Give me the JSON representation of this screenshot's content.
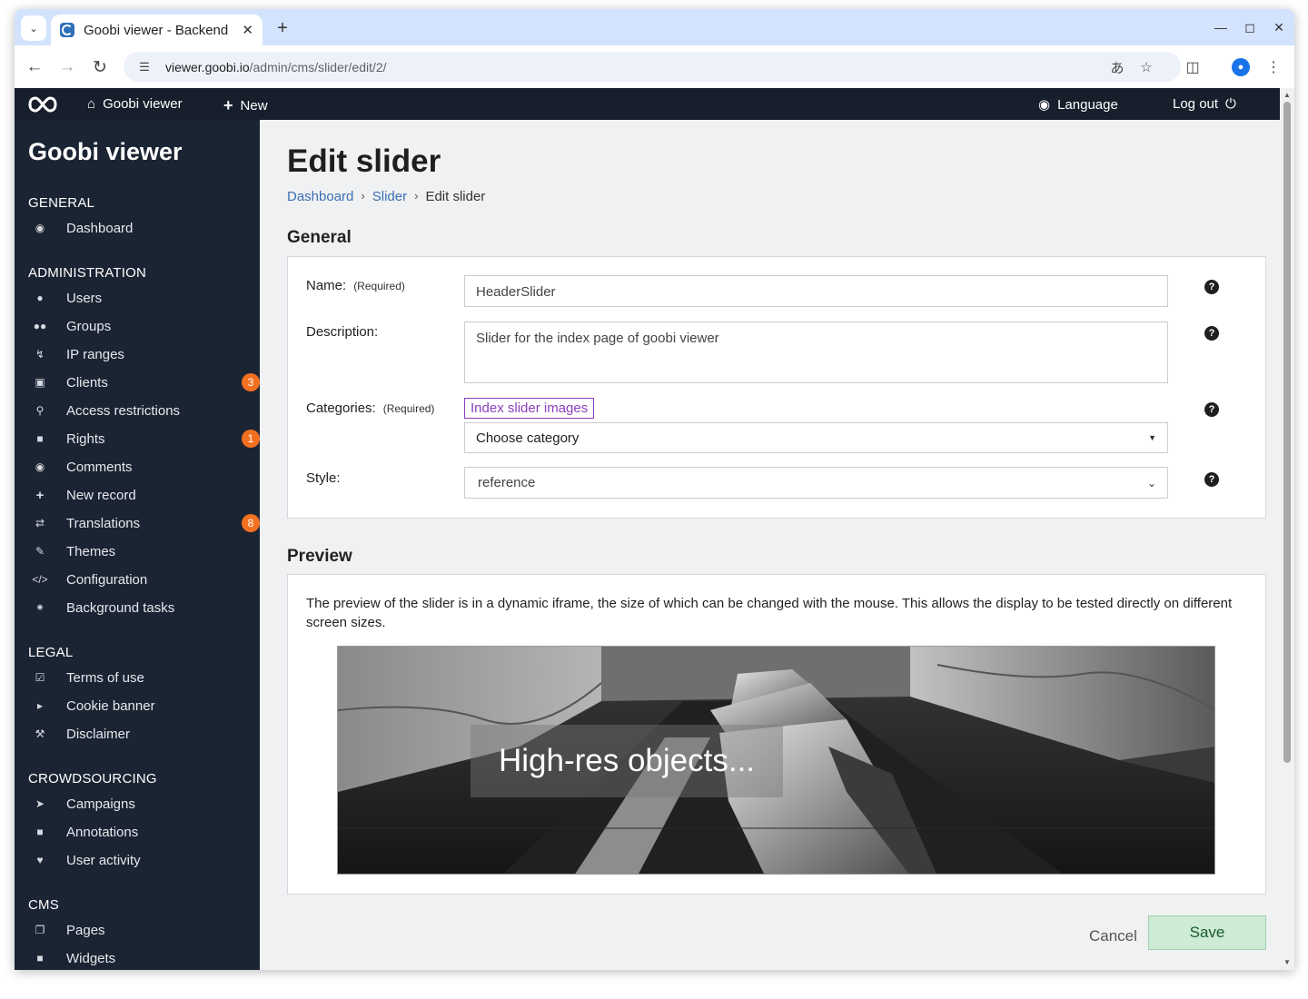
{
  "browser": {
    "tab_title": "Goobi viewer - Backend",
    "url_host": "viewer.goobi.io",
    "url_path": "/admin/cms/slider/edit/2/"
  },
  "appbar": {
    "home_label": "Goobi viewer",
    "new_label": "New",
    "language_label": "Language",
    "logout_label": "Log out"
  },
  "sidebar": {
    "brand": "Goobi viewer",
    "sections": [
      {
        "title": "GENERAL",
        "items": [
          {
            "label": "Dashboard",
            "icon": "dashboard-icon"
          }
        ]
      },
      {
        "title": "ADMINISTRATION",
        "items": [
          {
            "label": "Users",
            "icon": "user-icon"
          },
          {
            "label": "Groups",
            "icon": "users-icon"
          },
          {
            "label": "IP ranges",
            "icon": "bolt-icon"
          },
          {
            "label": "Clients",
            "icon": "monitor-icon",
            "badge": "3"
          },
          {
            "label": "Access restrictions",
            "icon": "key-icon"
          },
          {
            "label": "Rights",
            "icon": "lock-icon",
            "badge": "1"
          },
          {
            "label": "Comments",
            "icon": "comments-icon"
          },
          {
            "label": "New record",
            "icon": "plus-icon"
          },
          {
            "label": "Translations",
            "icon": "exchange-icon",
            "badge": "8"
          },
          {
            "label": "Themes",
            "icon": "brush-icon"
          },
          {
            "label": "Configuration",
            "icon": "code-icon"
          },
          {
            "label": "Background tasks",
            "icon": "spinner-icon"
          }
        ]
      },
      {
        "title": "LEGAL",
        "items": [
          {
            "label": "Terms of use",
            "icon": "checkbox-icon"
          },
          {
            "label": "Cookie banner",
            "icon": "megaphone-icon"
          },
          {
            "label": "Disclaimer",
            "icon": "gavel-icon"
          }
        ]
      },
      {
        "title": "CROWDSOURCING",
        "items": [
          {
            "label": "Campaigns",
            "icon": "rocket-icon"
          },
          {
            "label": "Annotations",
            "icon": "note-icon"
          },
          {
            "label": "User activity",
            "icon": "heartbeat-icon"
          }
        ]
      },
      {
        "title": "CMS",
        "items": [
          {
            "label": "Pages",
            "icon": "pages-icon"
          },
          {
            "label": "Widgets",
            "icon": "widget-icon"
          }
        ]
      }
    ]
  },
  "main": {
    "title": "Edit slider",
    "breadcrumb": {
      "dashboard": "Dashboard",
      "slider": "Slider",
      "current": "Edit slider"
    },
    "general_title": "General",
    "form": {
      "name_label": "Name:",
      "name_req": "(Required)",
      "name_value": "HeaderSlider",
      "description_label": "Description:",
      "description_value": "Slider for the index page of goobi viewer",
      "categories_label": "Categories:",
      "categories_req": "(Required)",
      "category_tag": "Index slider images",
      "category_select": "Choose category",
      "style_label": "Style:",
      "style_value": "reference",
      "help_glyph": "?"
    },
    "preview_title": "Preview",
    "preview_text": "The preview of the slider is in a dynamic iframe, the size of which can be changed with the mouse. This allows the display to be tested directly on different screen sizes.",
    "slide_caption": "High-res objects...",
    "cancel_label": "Cancel",
    "save_label": "Save"
  }
}
